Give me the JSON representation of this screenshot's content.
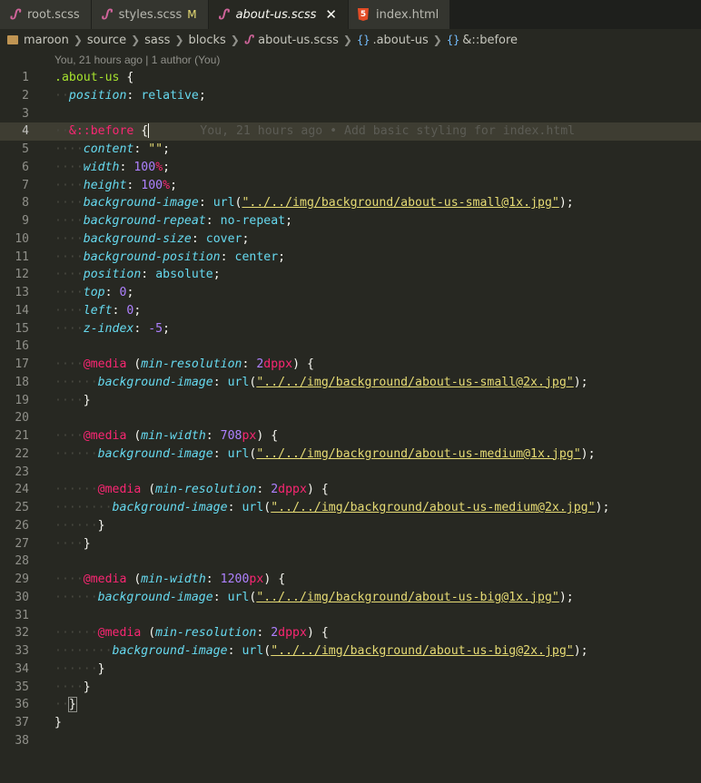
{
  "tabs": [
    {
      "name": "root.scss",
      "modified": "",
      "active": false,
      "icon": "sass-icon"
    },
    {
      "name": "styles.scss",
      "modified": "M",
      "active": false,
      "icon": "sass-icon"
    },
    {
      "name": "about-us.scss",
      "modified": "",
      "active": true,
      "icon": "sass-icon"
    },
    {
      "name": "index.html",
      "modified": "",
      "active": false,
      "icon": "html5-icon"
    }
  ],
  "breadcrumb": {
    "root": "maroon",
    "source": "source",
    "sass": "sass",
    "blocks": "blocks",
    "file": "about-us.scss",
    "symbol1": ".about-us",
    "symbol2": "&::before"
  },
  "blame": {
    "header": "You, 21 hours ago | 1 author (You)",
    "inline": "You, 21 hours ago • Add basic styling for index.html"
  },
  "editor": {
    "current_line": 4,
    "line_numbers": [
      "1",
      "2",
      "3",
      "4",
      "5",
      "6",
      "7",
      "8",
      "9",
      "10",
      "11",
      "12",
      "13",
      "14",
      "15",
      "16",
      "17",
      "18",
      "19",
      "20",
      "21",
      "22",
      "23",
      "24",
      "25",
      "26",
      "27",
      "28",
      "29",
      "30",
      "31",
      "32",
      "33",
      "34",
      "35",
      "36",
      "37",
      "38"
    ],
    "code": {
      "l1_sel": ".about-us",
      "l1_brace": " {",
      "l2_prop": "position",
      "l2_val": "relative",
      "l4_amp": "&::before",
      "l4_brace": " {",
      "l5_prop": "content",
      "l5_val": "\"\"",
      "l6_prop": "width",
      "l6_num": "100",
      "l6_unit": "%",
      "l7_prop": "height",
      "l7_num": "100",
      "l7_unit": "%",
      "l8_prop": "background-image",
      "l8_url": "\"../../img/background/about-us-small@1x.jpg\"",
      "l9_prop": "background-repeat",
      "l9_val": "no-repeat",
      "l10_prop": "background-size",
      "l10_val": "cover",
      "l11_prop": "background-position",
      "l11_val": "center",
      "l12_prop": "position",
      "l12_val": "absolute",
      "l13_prop": "top",
      "l13_num": "0",
      "l14_prop": "left",
      "l14_num": "0",
      "l15_prop": "z-index",
      "l15_num": "-5",
      "media": "@media",
      "min_resolution": "min-resolution",
      "min_width": "min-width",
      "dppx_num": "2",
      "dppx_unit": "dppx",
      "l18_url": "\"../../img/background/about-us-small@2x.jpg\"",
      "l21_num": "708",
      "px": "px",
      "l22_url": "\"../../img/background/about-us-medium@1x.jpg\"",
      "l25_url": "\"../../img/background/about-us-medium@2x.jpg\"",
      "l29_num": "1200",
      "l30_url": "\"../../img/background/about-us-big@1x.jpg\"",
      "l33_url": "\"../../img/background/about-us-big@2x.jpg\"",
      "bg_image_prop": "background-image"
    }
  },
  "colors": {
    "background": "#272822",
    "selector": "#a6e22e",
    "keyword": "#f92672",
    "property": "#66d9ef",
    "number": "#ae81ff",
    "string": "#e6db74"
  }
}
